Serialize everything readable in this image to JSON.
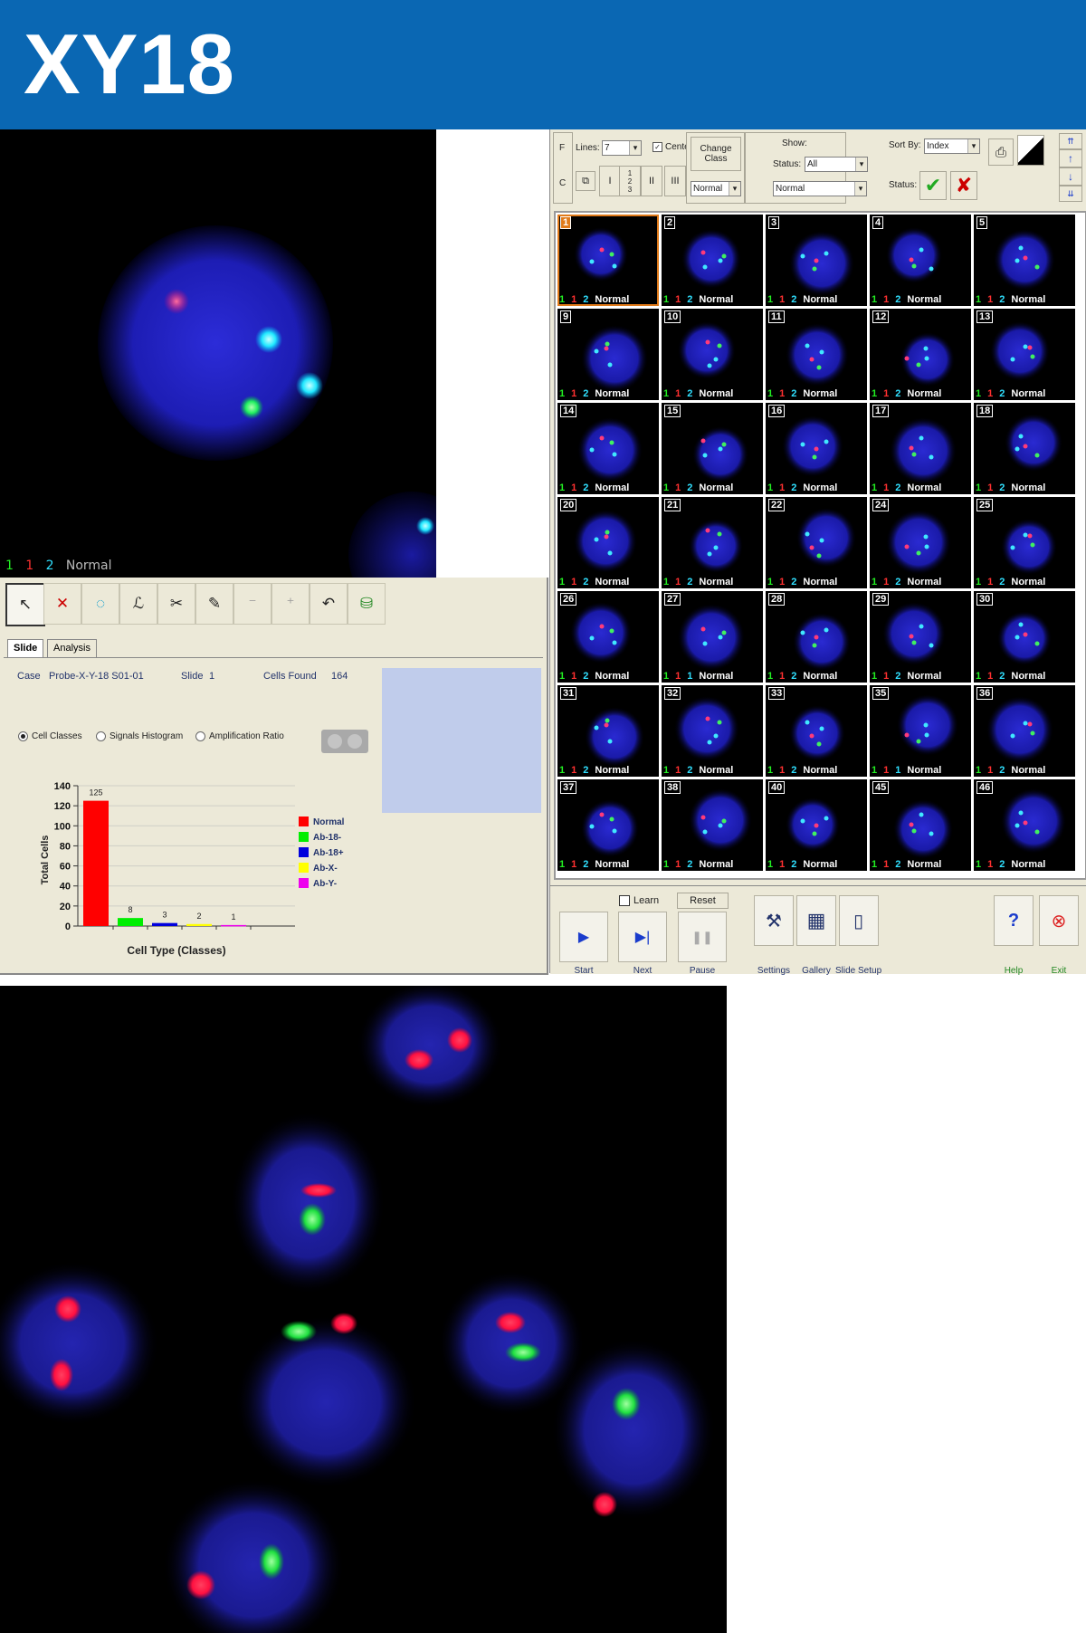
{
  "banner": {
    "title": "XY18"
  },
  "cell_view": {
    "label_green": "1",
    "label_red": "1",
    "label_aqua": "2",
    "label_status": "Normal"
  },
  "toolbar": {
    "f_label": "F",
    "c_label": "C",
    "lines_label": "Lines:",
    "lines_value": "7",
    "center_label": "Center",
    "btn_i": "I",
    "btn_ii": "II",
    "btn_iii": "III",
    "change_class_label": "Change Class",
    "class_value": "Normal",
    "show_label": "Show:",
    "status_label": "Status:",
    "status_value": "All",
    "class_filter_value": "Normal",
    "sort_by_label": "Sort By:",
    "sort_by_value": "Index",
    "status2_label": "Status:"
  },
  "gallery": {
    "cells": [
      {
        "num": "1",
        "g": "1",
        "r": "1",
        "a": "2",
        "status": "Normal"
      },
      {
        "num": "2",
        "g": "1",
        "r": "1",
        "a": "2",
        "status": "Normal"
      },
      {
        "num": "3",
        "g": "1",
        "r": "1",
        "a": "2",
        "status": "Normal"
      },
      {
        "num": "4",
        "g": "1",
        "r": "1",
        "a": "2",
        "status": "Normal"
      },
      {
        "num": "5",
        "g": "1",
        "r": "1",
        "a": "2",
        "status": "Normal"
      },
      {
        "num": "9",
        "g": "1",
        "r": "1",
        "a": "2",
        "status": "Normal"
      },
      {
        "num": "10",
        "g": "1",
        "r": "1",
        "a": "2",
        "status": "Normal"
      },
      {
        "num": "11",
        "g": "1",
        "r": "1",
        "a": "2",
        "status": "Normal"
      },
      {
        "num": "12",
        "g": "1",
        "r": "1",
        "a": "2",
        "status": "Normal"
      },
      {
        "num": "13",
        "g": "1",
        "r": "1",
        "a": "2",
        "status": "Normal"
      },
      {
        "num": "14",
        "g": "1",
        "r": "1",
        "a": "2",
        "status": "Normal"
      },
      {
        "num": "15",
        "g": "1",
        "r": "1",
        "a": "2",
        "status": "Normal"
      },
      {
        "num": "16",
        "g": "1",
        "r": "1",
        "a": "2",
        "status": "Normal"
      },
      {
        "num": "17",
        "g": "1",
        "r": "1",
        "a": "2",
        "status": "Normal"
      },
      {
        "num": "18",
        "g": "1",
        "r": "1",
        "a": "2",
        "status": "Normal"
      },
      {
        "num": "20",
        "g": "1",
        "r": "1",
        "a": "2",
        "status": "Normal"
      },
      {
        "num": "21",
        "g": "1",
        "r": "1",
        "a": "2",
        "status": "Normal"
      },
      {
        "num": "22",
        "g": "1",
        "r": "1",
        "a": "2",
        "status": "Normal"
      },
      {
        "num": "24",
        "g": "1",
        "r": "1",
        "a": "2",
        "status": "Normal"
      },
      {
        "num": "25",
        "g": "1",
        "r": "1",
        "a": "2",
        "status": "Normal"
      },
      {
        "num": "26",
        "g": "1",
        "r": "1",
        "a": "2",
        "status": "Normal"
      },
      {
        "num": "27",
        "g": "1",
        "r": "1",
        "a": "1",
        "status": "Normal"
      },
      {
        "num": "28",
        "g": "1",
        "r": "1",
        "a": "2",
        "status": "Normal"
      },
      {
        "num": "29",
        "g": "1",
        "r": "1",
        "a": "2",
        "status": "Normal"
      },
      {
        "num": "30",
        "g": "1",
        "r": "1",
        "a": "2",
        "status": "Normal"
      },
      {
        "num": "31",
        "g": "1",
        "r": "1",
        "a": "2",
        "status": "Normal"
      },
      {
        "num": "32",
        "g": "1",
        "r": "1",
        "a": "2",
        "status": "Normal"
      },
      {
        "num": "33",
        "g": "1",
        "r": "1",
        "a": "2",
        "status": "Normal"
      },
      {
        "num": "35",
        "g": "1",
        "r": "1",
        "a": "1",
        "status": "Normal"
      },
      {
        "num": "36",
        "g": "1",
        "r": "1",
        "a": "2",
        "status": "Normal"
      },
      {
        "num": "37",
        "g": "1",
        "r": "1",
        "a": "2",
        "status": "Normal"
      },
      {
        "num": "38",
        "g": "1",
        "r": "1",
        "a": "2",
        "status": "Normal"
      },
      {
        "num": "40",
        "g": "1",
        "r": "1",
        "a": "2",
        "status": "Normal"
      },
      {
        "num": "45",
        "g": "1",
        "r": "1",
        "a": "2",
        "status": "Normal"
      },
      {
        "num": "46",
        "g": "1",
        "r": "1",
        "a": "2",
        "status": "Normal"
      }
    ]
  },
  "bottom_bar": {
    "learn_label": "Learn",
    "reset_label": "Reset",
    "start_label": "Start",
    "next_label": "Next",
    "pause_label": "Pause",
    "settings_label": "Settings",
    "gallery_label": "Gallery",
    "slide_setup_label": "Slide Setup",
    "help_label": "Help",
    "exit_label": "Exit"
  },
  "analysis_panel": {
    "tab_slide": "Slide",
    "tab_analysis": "Analysis",
    "case_label": "Case",
    "case_value": "Probe-X-Y-18 S01-01",
    "slide_label": "Slide",
    "slide_value": "1",
    "cells_found_label": "Cells Found",
    "cells_found_value": "164",
    "radio_cell_classes": "Cell Classes",
    "radio_signals_histogram": "Signals Histogram",
    "radio_amplification_ratio": "Amplification Ratio"
  },
  "chart_data": {
    "type": "bar",
    "categories": [
      "Normal",
      "Ab-18-",
      "Ab-18+",
      "Ab-X-",
      "Ab-Y-"
    ],
    "values": [
      125,
      8,
      3,
      2,
      1
    ],
    "colors": [
      "#ff0000",
      "#00ee00",
      "#0000dd",
      "#ffff00",
      "#ee00ee"
    ],
    "xlabel": "Cell Type (Classes)",
    "ylabel": "Total Cells",
    "ylim": [
      0,
      140
    ],
    "yticks": [
      0,
      20,
      40,
      60,
      80,
      100,
      120,
      140
    ],
    "grid": true,
    "legend": "right"
  },
  "colors": {
    "banner": "#0a67b3",
    "panel": "#ece9d8",
    "selection": "#e07a1a"
  }
}
